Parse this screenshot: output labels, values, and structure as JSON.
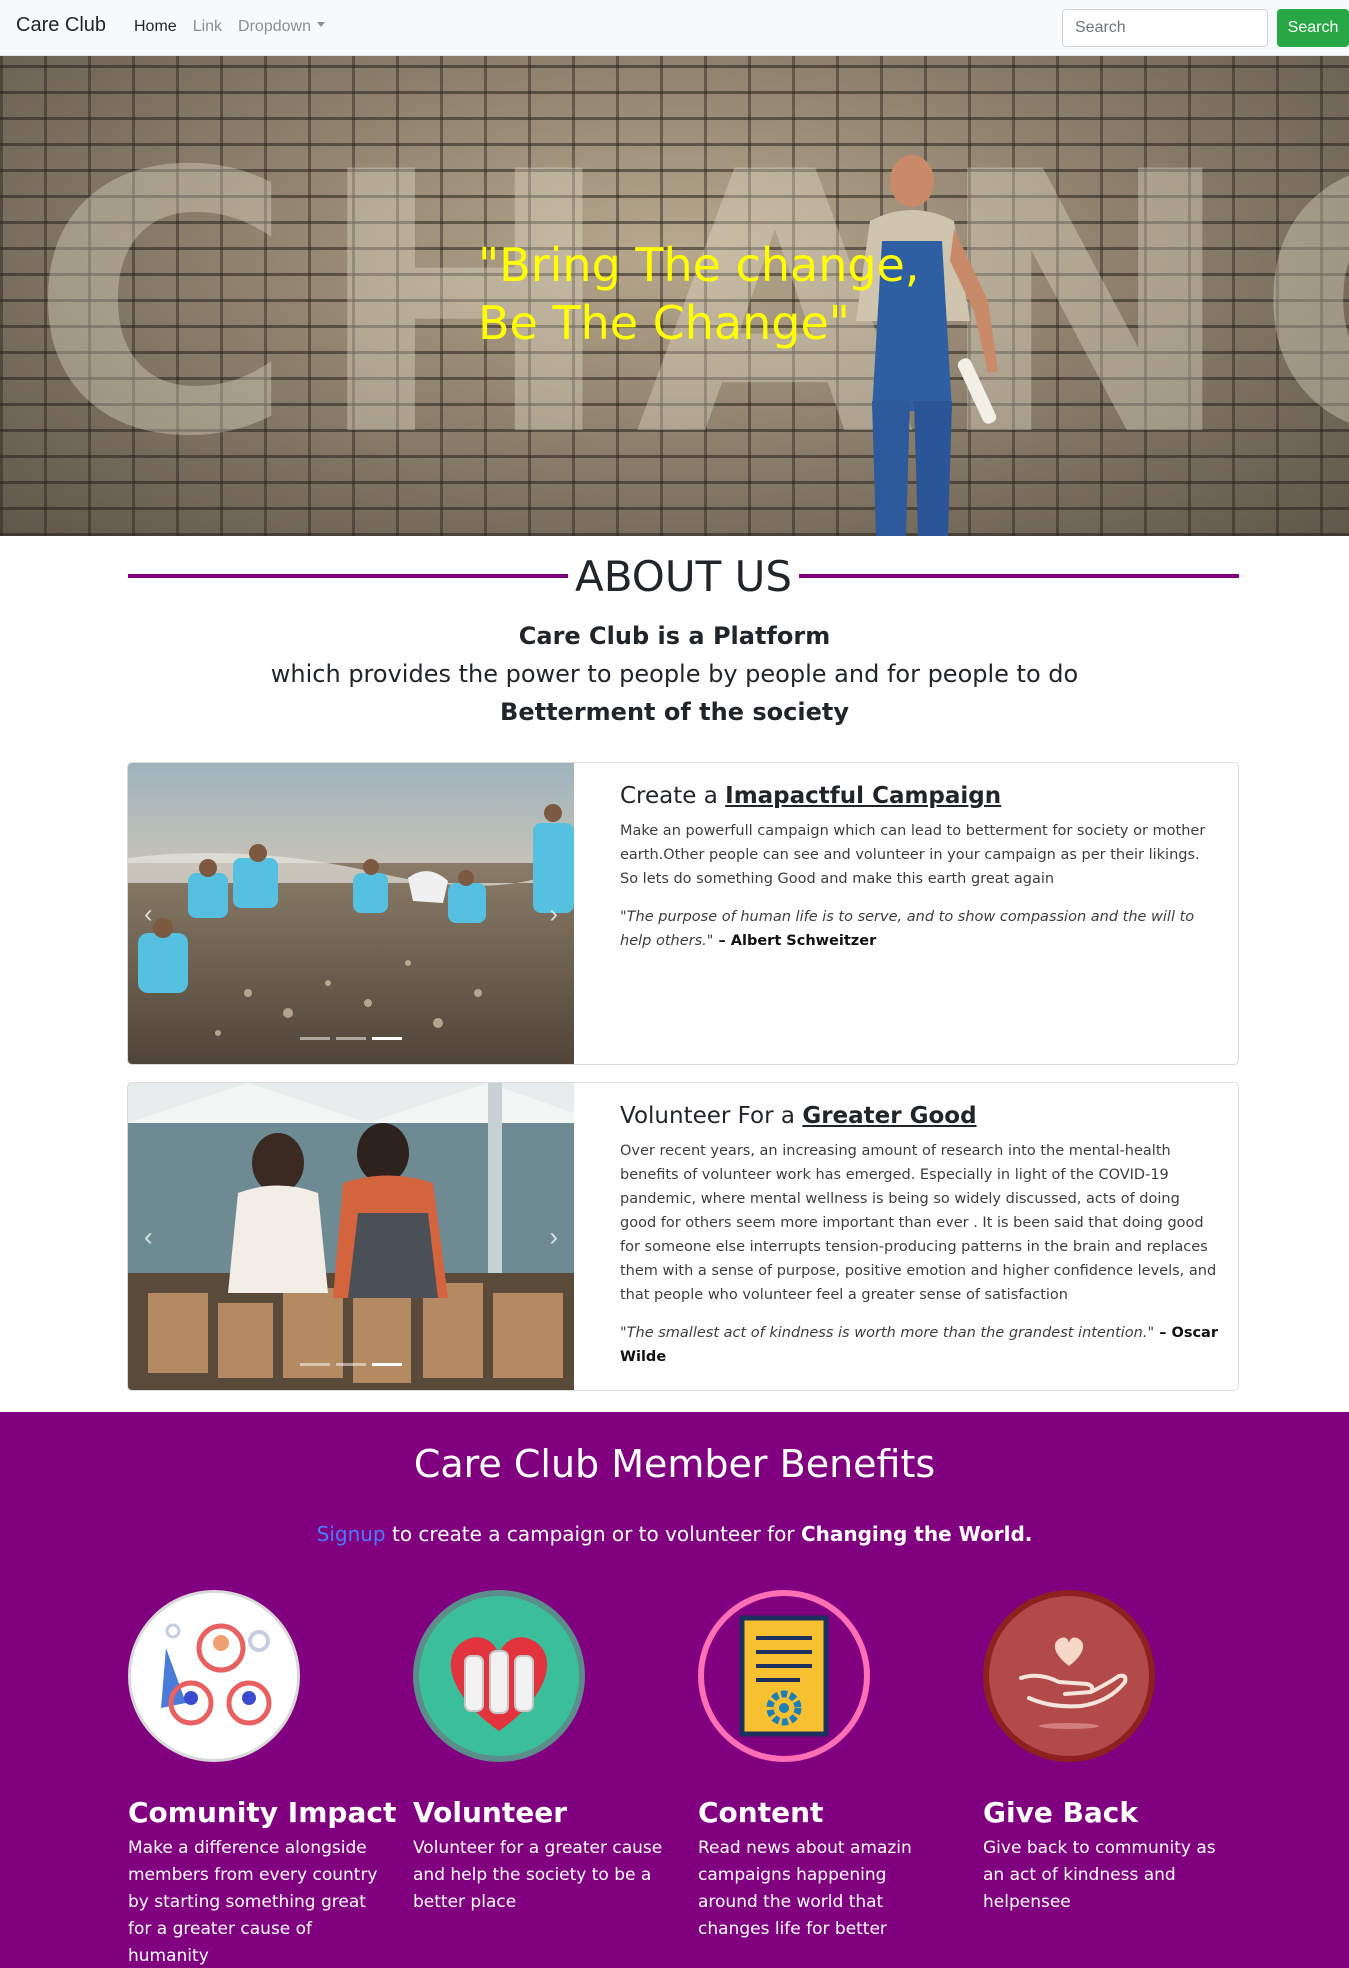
{
  "navbar": {
    "brand": "Care Club",
    "links": [
      "Home",
      "Link",
      "Dropdown"
    ],
    "search_placeholder": "Search",
    "search_button": "Search"
  },
  "hero": {
    "quote_line1": "\"Bring The change,",
    "quote_line2": "Be The Change\"",
    "quote_color": "#ffff00"
  },
  "about": {
    "title": "ABOUT US",
    "line1": "Care Club is a Platform",
    "line2": "which provides the power to people by people and for people to do",
    "line3": "Betterment of the society",
    "accent": "#800080"
  },
  "cards": [
    {
      "title_prefix": "Create a ",
      "title_link": "Imapactful Campaign",
      "text": "Make an powerfull campaign which can lead to betterment for society or mother earth.Other people can see and volunteer in your campaign as per their likings. So lets do something Good and make this earth great again",
      "quote": "\"The purpose of human life is to serve, and to show compassion and the will to help others.\"",
      "author": " – Albert Schweitzer"
    },
    {
      "title_prefix": "Volunteer For a ",
      "title_link": "Greater Good",
      "text": "Over recent years, an increasing amount of research into the mental-health benefits of volunteer work has emerged. Especially in light of the COVID-19 pandemic, where mental wellness is being so widely discussed, acts of doing good for others seem more important than ever . It is been said that doing good for someone else interrupts tension-producing patterns in the brain and replaces them with a sense of purpose, positive emotion and higher confidence levels, and that people who volunteer feel a greater sense of satisfaction",
      "quote": "\"The smallest act of kindness is worth more than the grandest intention.\"",
      "author": " – Oscar Wilde"
    }
  ],
  "benefits": {
    "title": "Care Club Member Benefits",
    "signup": "Signup",
    "sub_mid": " to create a campaign or to volunteer for ",
    "sub_bold": "Changing the World.",
    "bg": "#800080",
    "items": [
      {
        "heading": "Comunity Impact",
        "text": "Make a difference alongside members from every country by starting something great for a greater cause of humanity"
      },
      {
        "heading": "Volunteer",
        "text": "Volunteer for a greater cause and help the society to be a better place"
      },
      {
        "heading": "Content",
        "text": "Read news about amazin campaigns happening around the world that changes life for better"
      },
      {
        "heading": "Give Back",
        "text": "Give back to community as an act of kindness and helpensee"
      }
    ]
  }
}
